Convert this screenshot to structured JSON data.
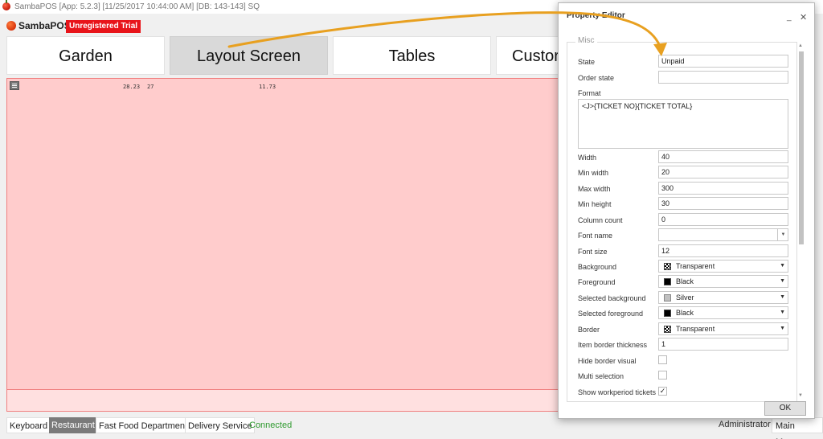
{
  "window": {
    "title": "SambaPOS [App: 5.2.3] [11/25/2017 10:44:00 AM] [DB: 143-143] SQ"
  },
  "brand": {
    "logo_text": "SambaPOS",
    "trial_badge": "Unregistered Trial",
    "badge_color": "#e8141a"
  },
  "tabs": [
    {
      "label": "Garden",
      "active": false
    },
    {
      "label": "Layout Screen Design",
      "active": true
    },
    {
      "label": "Tables",
      "active": false
    },
    {
      "label": "Custor",
      "active": false
    }
  ],
  "canvas": {
    "background_color": "#ffcccc",
    "values": [
      "28.23",
      "27",
      "11.73"
    ]
  },
  "statusbar": {
    "items": [
      "Keyboard",
      "Restaurant",
      "Fast Food Department",
      "Delivery Service"
    ],
    "active_item": "Restaurant",
    "connection": "Connected",
    "user": "Administrator",
    "main_menu": "Main Menu"
  },
  "dialog": {
    "title": "Property Editor",
    "group_label": "Misc",
    "ok_label": "OK",
    "properties": {
      "state": {
        "label": "State",
        "value": "Unpaid"
      },
      "order_state": {
        "label": "Order state",
        "value": ""
      },
      "format": {
        "label": "Format",
        "value": "<J>{TICKET NO}{TICKET TOTAL}"
      },
      "width": {
        "label": "Width",
        "value": "40"
      },
      "min_width": {
        "label": "Min width",
        "value": "20"
      },
      "max_width": {
        "label": "Max width",
        "value": "300"
      },
      "min_height": {
        "label": "Min height",
        "value": "30"
      },
      "column_count": {
        "label": "Column count",
        "value": "0"
      },
      "font_name": {
        "label": "Font name",
        "value": ""
      },
      "font_size": {
        "label": "Font size",
        "value": "12"
      },
      "background": {
        "label": "Background",
        "value": "Transparent"
      },
      "foreground": {
        "label": "Foreground",
        "value": "Black"
      },
      "selected_background": {
        "label": "Selected background",
        "value": "Silver"
      },
      "selected_foreground": {
        "label": "Selected foreground",
        "value": "Black"
      },
      "border": {
        "label": "Border",
        "value": "Transparent"
      },
      "item_border_thickness": {
        "label": "Item border thickness",
        "value": "1"
      },
      "hide_border_visual": {
        "label": "Hide border visual",
        "checked": false
      },
      "multi_selection": {
        "label": "Multi selection",
        "checked": false
      },
      "show_workperiod_tickets": {
        "label": "Show workperiod tickets",
        "checked": true
      }
    }
  },
  "annotation": {
    "arrow_color": "#e8a020"
  }
}
